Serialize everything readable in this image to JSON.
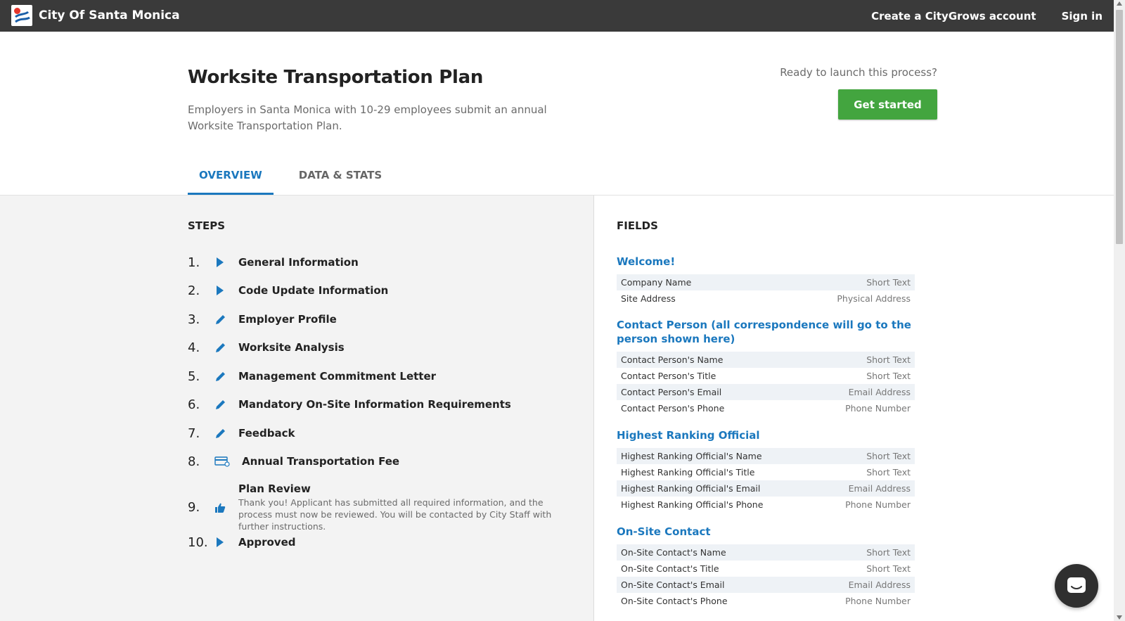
{
  "topbar": {
    "brand": "City Of Santa Monica",
    "links": [
      "Create a CityGrows account",
      "Sign in"
    ],
    "bg_color": "#3a3a3a"
  },
  "header": {
    "title": "Worksite Transportation Plan",
    "subtitle": "Employers in Santa Monica with 10-29 employees submit an annual Worksite Transportation Plan.",
    "ready_text": "Ready to launch this process?",
    "cta_label": "Get started",
    "cta_color": "#43a53f"
  },
  "tabs": [
    {
      "label": "OVERVIEW",
      "active": true
    },
    {
      "label": "DATA & STATS",
      "active": false
    }
  ],
  "steps_section": {
    "heading": "STEPS",
    "items": [
      {
        "num": "1.",
        "icon": "play-icon",
        "label": "General Information"
      },
      {
        "num": "2.",
        "icon": "play-icon",
        "label": "Code Update Information"
      },
      {
        "num": "3.",
        "icon": "pencil-icon",
        "label": "Employer Profile"
      },
      {
        "num": "4.",
        "icon": "pencil-icon",
        "label": "Worksite Analysis"
      },
      {
        "num": "5.",
        "icon": "pencil-icon",
        "label": "Management Commitment Letter"
      },
      {
        "num": "6.",
        "icon": "pencil-icon",
        "label": "Mandatory On-Site Information Requirements"
      },
      {
        "num": "7.",
        "icon": "pencil-icon",
        "label": "Feedback"
      },
      {
        "num": "8.",
        "icon": "credit-card-icon",
        "label": "Annual Transportation Fee"
      },
      {
        "num": "9.",
        "icon": "thumbs-up-icon",
        "label": "Plan Review",
        "description": "Thank you! Applicant has submitted all required information, and the process must now be reviewed. You will be contacted by City Staff with further instructions."
      },
      {
        "num": "10.",
        "icon": "play-icon",
        "label": "Approved"
      }
    ]
  },
  "fields_section": {
    "heading": "FIELDS",
    "groups": [
      {
        "title": "Welcome!",
        "fields": [
          {
            "name": "Company Name",
            "type": "Short Text"
          },
          {
            "name": "Site Address",
            "type": "Physical Address"
          }
        ]
      },
      {
        "title": "Contact Person (all correspondence will go to the person shown here)",
        "fields": [
          {
            "name": "Contact Person's Name",
            "type": "Short Text"
          },
          {
            "name": "Contact Person's Title",
            "type": "Short Text"
          },
          {
            "name": "Contact Person's Email",
            "type": "Email Address"
          },
          {
            "name": "Contact Person's Phone",
            "type": "Phone Number"
          }
        ]
      },
      {
        "title": "Highest Ranking Official",
        "fields": [
          {
            "name": "Highest Ranking Official's Name",
            "type": "Short Text"
          },
          {
            "name": "Highest Ranking Official's Title",
            "type": "Short Text"
          },
          {
            "name": "Highest Ranking Official's Email",
            "type": "Email Address"
          },
          {
            "name": "Highest Ranking Official's Phone",
            "type": "Phone Number"
          }
        ]
      },
      {
        "title": "On-Site Contact",
        "fields": [
          {
            "name": "On-Site Contact's Name",
            "type": "Short Text"
          },
          {
            "name": "On-Site Contact's Title",
            "type": "Short Text"
          },
          {
            "name": "On-Site Contact's Email",
            "type": "Email Address"
          },
          {
            "name": "On-Site Contact's Phone",
            "type": "Phone Number"
          }
        ]
      }
    ]
  },
  "colors": {
    "accent": "#1b78be",
    "row_alt": "#eef2f6",
    "panel_bg": "#f3f3f3"
  }
}
